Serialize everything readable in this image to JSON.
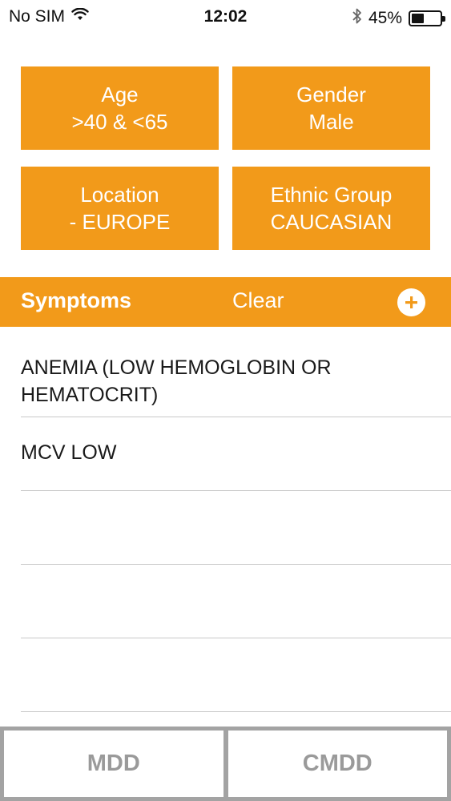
{
  "status_bar": {
    "carrier": "No SIM",
    "time": "12:02",
    "battery_percent": "45%",
    "battery_level": 0.45,
    "wifi_icon": "wifi-icon",
    "bluetooth_icon": "bluetooth-icon"
  },
  "filters": {
    "age": {
      "label": "Age",
      "value": ">40 & <65"
    },
    "gender": {
      "label": "Gender",
      "value": "Male"
    },
    "location": {
      "label": "Location",
      "value": "- EUROPE"
    },
    "ethnic_group": {
      "label": "Ethnic Group",
      "value": "CAUCASIAN"
    }
  },
  "symptoms_bar": {
    "title": "Symptoms",
    "clear_label": "Clear",
    "add_icon": "plus-icon"
  },
  "symptoms": [
    "ANEMIA (LOW HEMOGLOBIN OR HEMATOCRIT)",
    "MCV LOW",
    "",
    "",
    ""
  ],
  "bottom_buttons": {
    "mdd_label": "MDD",
    "cmdd_label": "CMDD"
  },
  "colors": {
    "accent": "#f29a1a",
    "bottom_button_text": "#9a9a9a"
  }
}
